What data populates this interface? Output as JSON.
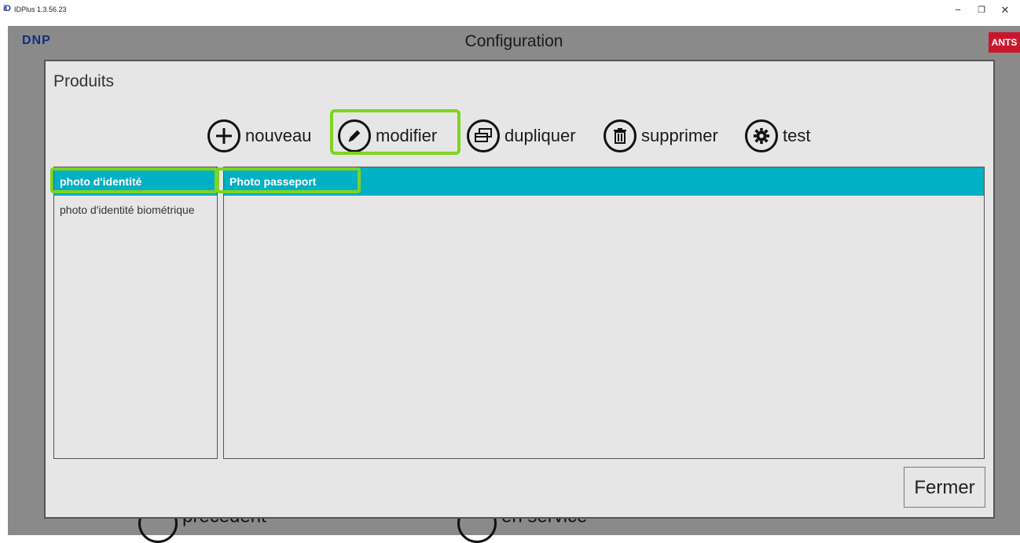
{
  "window": {
    "title": "IDPlus 1.3.56.23",
    "icon_text": "iD",
    "minimize": "−",
    "maximize": "❐",
    "close": "✕"
  },
  "header": {
    "logo": "DNP",
    "title": "Configuration",
    "badge": "ANTS"
  },
  "background_nav": {
    "previous": "precedent",
    "in_service": "en service"
  },
  "dialog": {
    "title": "Produits",
    "toolbar": [
      {
        "label": "nouveau",
        "icon": "plus-icon"
      },
      {
        "label": "modifier",
        "icon": "pencil-icon"
      },
      {
        "label": "dupliquer",
        "icon": "duplicate-icon"
      },
      {
        "label": "supprimer",
        "icon": "trash-icon"
      },
      {
        "label": "test",
        "icon": "gear-icon"
      }
    ],
    "categories": [
      {
        "label": "photo d'identité",
        "selected": true
      },
      {
        "label": "photo d'identité biométrique",
        "selected": false
      }
    ],
    "products": [
      {
        "label": "Photo passeport",
        "selected": true
      }
    ],
    "close_label": "Fermer"
  },
  "colors": {
    "selection": "#00b0c4",
    "highlight": "#7fd321",
    "badge": "#c8172c",
    "logo": "#0f2f80"
  }
}
